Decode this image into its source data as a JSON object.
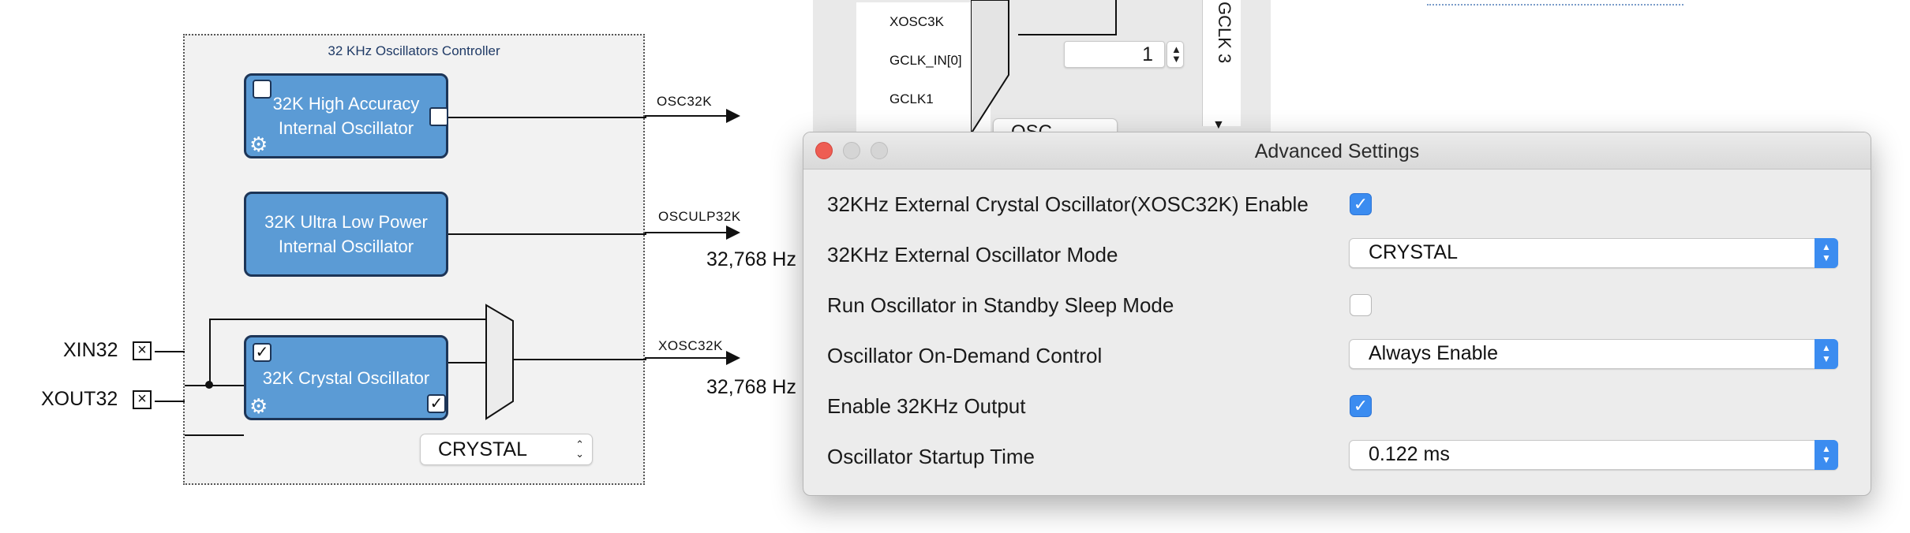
{
  "diagram": {
    "title": "32 KHz Oscillators Controller",
    "blocks": {
      "high_accuracy": {
        "line1": "32K High Accuracy",
        "line2": "Internal Oscillator"
      },
      "ultra_low_power": {
        "line1": "32K Ultra Low Power",
        "line2": "Internal Oscillator"
      },
      "crystal": {
        "line1": "32K Crystal Oscillator"
      }
    },
    "signals": {
      "osc32k": "OSC32K",
      "osculp32k": "OSCULP32K",
      "xosc32k": "XOSC32K"
    },
    "frequencies": {
      "osculp32k": "32,768 Hz",
      "xosc32k": "32,768 Hz"
    },
    "pins": {
      "xin": "XIN32",
      "xout": "XOUT32"
    },
    "mode_select": {
      "value": "CRYSTAL"
    }
  },
  "gclk_panel": {
    "inputs": [
      "XOSC3K",
      "GCLK_IN[0]",
      "GCLK1"
    ],
    "spinner_value": "1",
    "vertical_label": "GCLK 3",
    "osc_select_partial": "OSC"
  },
  "dialog": {
    "title": "Advanced Settings",
    "rows": [
      {
        "label": "32KHz External Crystal Oscillator(XOSC32K) Enable",
        "control": "checkbox",
        "checked": true
      },
      {
        "label": "32KHz External Oscillator Mode",
        "control": "select",
        "value": "CRYSTAL"
      },
      {
        "label": "Run Oscillator in Standby Sleep Mode",
        "control": "checkbox",
        "checked": false
      },
      {
        "label": "Oscillator On-Demand Control",
        "control": "select",
        "value": "Always Enable"
      },
      {
        "label": "Enable 32KHz Output",
        "control": "checkbox",
        "checked": true
      },
      {
        "label": "Oscillator Startup Time",
        "control": "select",
        "value": "0.122 ms"
      }
    ]
  },
  "colors": {
    "block_fill": "#5b9bd5",
    "block_border": "#1d3557",
    "checkbox_accent": "#3b8cf0",
    "close_button": "#ee5d53"
  }
}
